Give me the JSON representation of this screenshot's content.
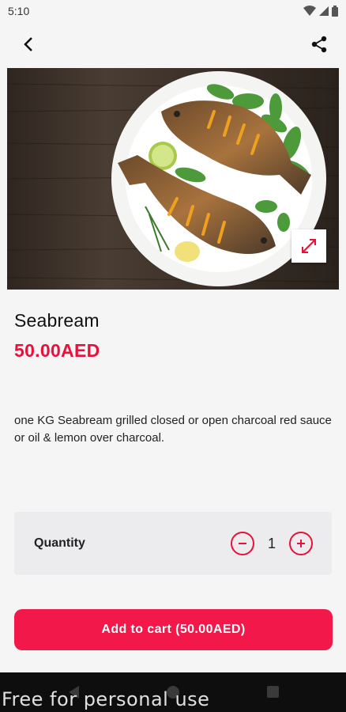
{
  "status": {
    "time": "5:10"
  },
  "product": {
    "name": "Seabream",
    "price": "50.00AED",
    "description": "one KG Seabream grilled closed or open charcoal red sauce or oil & lemon over charcoal."
  },
  "quantity": {
    "label": "Quantity",
    "value": "1"
  },
  "cart": {
    "button_label": "Add to cart (50.00AED)"
  },
  "watermark": "Free for personal use",
  "colors": {
    "accent": "#e8113b",
    "button": "#f2184a",
    "background": "#f5f5f6",
    "card": "#ecebee"
  },
  "icons": [
    "wifi-icon",
    "signal-icon",
    "battery-icon",
    "back-arrow-icon",
    "share-icon",
    "expand-icon",
    "minus-icon",
    "plus-icon"
  ]
}
